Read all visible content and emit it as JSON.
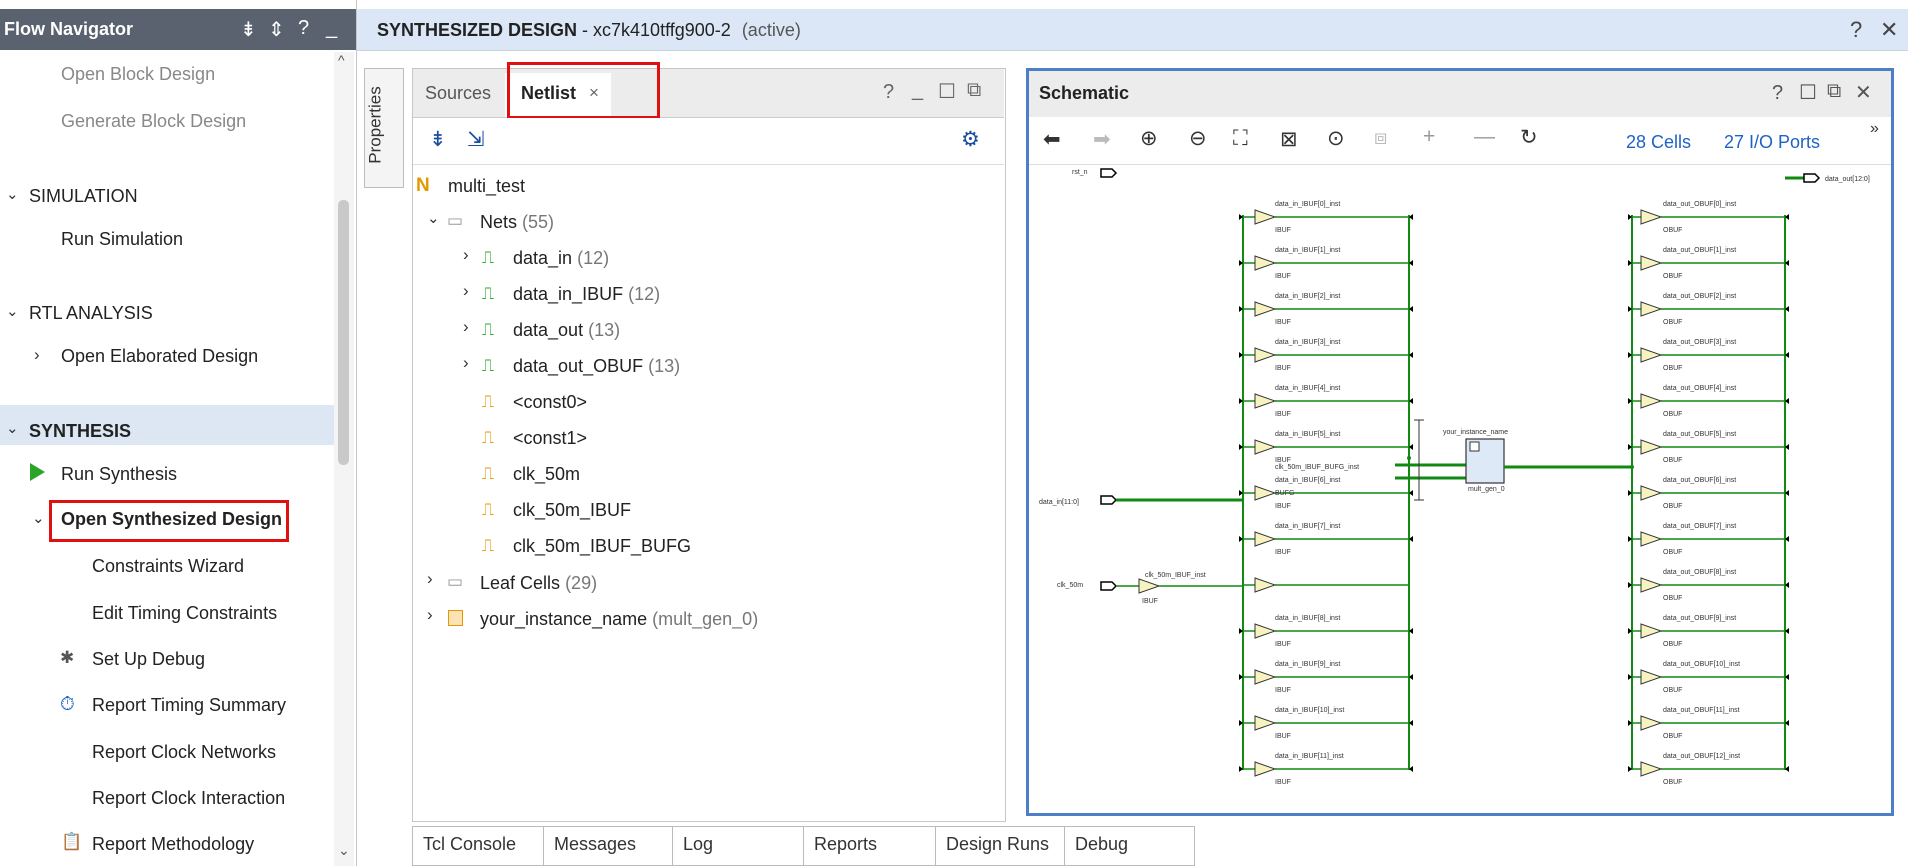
{
  "flow_navigator": {
    "title": "Flow Navigator",
    "items": {
      "open_block_design": "Open Block Design",
      "generate_block_design": "Generate Block Design",
      "simulation": "SIMULATION",
      "run_simulation": "Run Simulation",
      "rtl_analysis": "RTL ANALYSIS",
      "open_elaborated_design": "Open Elaborated Design",
      "synthesis": "SYNTHESIS",
      "run_synthesis": "Run Synthesis",
      "open_synthesized_design": "Open Synthesized Design",
      "constraints_wizard": "Constraints Wizard",
      "edit_timing_constraints": "Edit Timing Constraints",
      "set_up_debug": "Set Up Debug",
      "report_timing_summary": "Report Timing Summary",
      "report_clock_networks": "Report Clock Networks",
      "report_clock_interaction": "Report Clock Interaction",
      "report_methodology": "Report Methodology"
    }
  },
  "design_header": {
    "name": "SYNTHESIZED DESIGN",
    "part": " - xc7k410tffg900-2",
    "status": "(active)"
  },
  "properties_tab": "Properties",
  "netlist_panel": {
    "tabs": {
      "sources": "Sources",
      "netlist": "Netlist"
    },
    "root": "multi_test",
    "nets": {
      "label": "Nets",
      "count": "(55)"
    },
    "net_items": [
      {
        "name": "data_in",
        "count": "(12)"
      },
      {
        "name": "data_in_IBUF",
        "count": "(12)"
      },
      {
        "name": "data_out",
        "count": "(13)"
      },
      {
        "name": "data_out_OBUF",
        "count": "(13)"
      },
      {
        "name": "<const0>",
        "count": ""
      },
      {
        "name": "<const1>",
        "count": ""
      },
      {
        "name": "clk_50m",
        "count": ""
      },
      {
        "name": "clk_50m_IBUF",
        "count": ""
      },
      {
        "name": "clk_50m_IBUF_BUFG",
        "count": ""
      }
    ],
    "leaf_cells": {
      "label": "Leaf Cells",
      "count": "(29)"
    },
    "instance": {
      "label": "your_instance_name",
      "count": "(mult_gen_0)"
    }
  },
  "schematic": {
    "title": "Schematic",
    "cells": "28 Cells",
    "ports": "27 I/O Ports",
    "labels": {
      "rst_n": "rst_n",
      "clk_50m": "clk_50m",
      "data_in": "data_in[11:0]",
      "data_out": "data_out[12:0]",
      "clk_ibuf_inst": "clk_50m_IBUF_inst",
      "ibuf": "IBUF",
      "obuf": "OBUF",
      "bufg": "BUFG",
      "bufg_inst": "clk_50m_IBUF_BUFG_inst",
      "instance": "your_instance_name",
      "mult": "mult_gen_0"
    },
    "ibuf_instances": [
      "data_in_IBUF[0]_inst",
      "data_in_IBUF[1]_inst",
      "data_in_IBUF[2]_inst",
      "data_in_IBUF[3]_inst",
      "data_in_IBUF[4]_inst",
      "data_in_IBUF[5]_inst",
      "data_in_IBUF[6]_inst",
      "data_in_IBUF[7]_inst",
      "data_in_IBUF[8]_inst",
      "data_in_IBUF[9]_inst",
      "data_in_IBUF[10]_inst",
      "data_in_IBUF[11]_inst"
    ],
    "obuf_instances": [
      "data_out_OBUF[0]_inst",
      "data_out_OBUF[1]_inst",
      "data_out_OBUF[2]_inst",
      "data_out_OBUF[3]_inst",
      "data_out_OBUF[4]_inst",
      "data_out_OBUF[5]_inst",
      "data_out_OBUF[6]_inst",
      "data_out_OBUF[7]_inst",
      "data_out_OBUF[8]_inst",
      "data_out_OBUF[9]_inst",
      "data_out_OBUF[10]_inst",
      "data_out_OBUF[11]_inst",
      "data_out_OBUF[12]_inst"
    ]
  },
  "bottom_tabs": [
    "Tcl Console",
    "Messages",
    "Log",
    "Reports",
    "Design Runs",
    "Debug"
  ],
  "colors": {
    "header_dark": "#5a6270",
    "highlight_red": "#e01010",
    "link_blue": "#1f62c4",
    "wire_green": "#118a11",
    "schem_border": "#4c7fc7"
  }
}
